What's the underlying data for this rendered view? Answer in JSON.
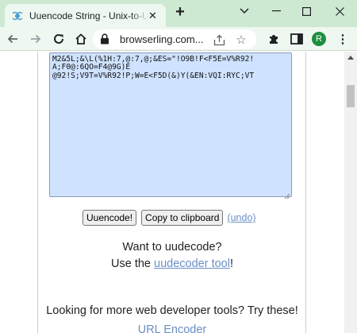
{
  "browser": {
    "tab": {
      "title": "Uuencode String - Unix-to-Unix Encoder",
      "favicon": "browserling-favicon-icon"
    },
    "window_controls": [
      "tab-search",
      "minimize",
      "maximize",
      "close"
    ],
    "toolbar": {
      "url": "browserling.com...",
      "profile_initial": "R"
    }
  },
  "page": {
    "output_text": "M2&5L;&\\L(%1H:7,@:7,@;&ES=\"!O9B!F<F5E=V%R92!\nA;F0@:6QO=F4@9G)E\n@92!S;V9T=V%R92!P;W=E<F5D(&)Y(&EN:VQI:RYC;VT",
    "buttons": {
      "uuencode": "Uuencode!",
      "copy": "Copy to clipboard",
      "undo": "(undo)"
    },
    "decode": {
      "title": "Want to uudecode?",
      "prefix": "Use the ",
      "link": "uudecoder tool",
      "suffix": "!"
    },
    "more_tools": "Looking for more web developer tools? Try these!",
    "tool_links": [
      "URL Encoder"
    ]
  }
}
